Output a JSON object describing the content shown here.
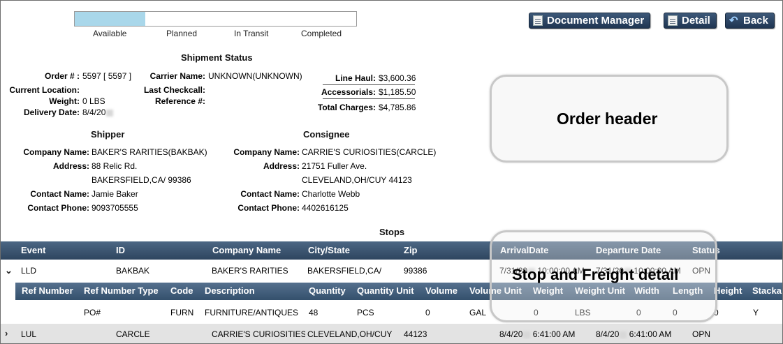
{
  "progress": {
    "fill_fraction": 0.25,
    "stages": [
      "Available",
      "Planned",
      "In Transit",
      "Completed"
    ]
  },
  "buttons": {
    "document_manager": "Document Manager",
    "detail": "Detail",
    "back": "Back"
  },
  "shipment_status": {
    "title": "Shipment Status",
    "order_label": "Order # :",
    "order_value": "5597 [ 5597 ]",
    "current_location_label": "Current Location:",
    "current_location_value": "",
    "weight_label": "Weight:",
    "weight_value": "0 LBS",
    "delivery_date_label": "Delivery Date:",
    "delivery_date_value": "8/4/20",
    "carrier_name_label": "Carrier Name:",
    "carrier_name_value": "UNKNOWN(UNKNOWN)",
    "last_checkcall_label": "Last Checkcall:",
    "last_checkcall_value": "",
    "reference_label": "Reference #:",
    "reference_value": "",
    "line_haul_label": "Line Haul:",
    "line_haul_value": "$3,600.36",
    "accessorials_label": "Accessorials:",
    "accessorials_value": "$1,185.50",
    "total_charges_label": "Total Charges:",
    "total_charges_value": "$4,785.86"
  },
  "shipper": {
    "title": "Shipper",
    "company_label": "Company Name:",
    "company_value": "BAKER'S RARITIES(BAKBAK)",
    "address_label": "Address:",
    "address_line1": "88 Relic Rd.",
    "address_line2": "BAKERSFIELD,CA/ 99386",
    "contact_name_label": "Contact Name:",
    "contact_name_value": "Jamie Baker",
    "contact_phone_label": "Contact Phone:",
    "contact_phone_value": "9093705555"
  },
  "consignee": {
    "title": "Consignee",
    "company_label": "Company Name:",
    "company_value": "CARRIE'S CURIOSITIES(CARCLE)",
    "address_label": "Address:",
    "address_line1": "21751 Fuller Ave.",
    "address_line2": "CLEVELAND,OH/CUY 44123",
    "contact_name_label": "Contact Name:",
    "contact_name_value": "Charlotte Webb",
    "contact_phone_label": "Contact Phone:",
    "contact_phone_value": "4402616125"
  },
  "callouts": {
    "order_header": "Order header",
    "stop_freight": "Stop and Freight detail"
  },
  "stops": {
    "title": "Stops",
    "columns": [
      "Event",
      "ID",
      "Company Name",
      "City/State",
      "Zip",
      "ArrivalDate",
      "Departure Date",
      "Status"
    ],
    "rows": [
      {
        "expand": "⌄",
        "event": "LLD",
        "id": "BAKBAK",
        "company": "BAKER'S RARITIES",
        "city": "BAKERSFIELD,CA/",
        "zip": "99386",
        "arrival_prefix": "7/31/20",
        "arrival_time": "10:00:00 AM",
        "departure_prefix": "7/31/20",
        "departure_time": "10:00:00 AM",
        "status": "OPN"
      },
      {
        "expand": "›",
        "event": "LUL",
        "id": "CARCLE",
        "company": "CARRIE'S CURIOSITIES",
        "city": "CLEVELAND,OH/CUY",
        "zip": "44123",
        "arrival_prefix": "8/4/20",
        "arrival_time": "6:41:00 AM",
        "departure_prefix": "8/4/20",
        "departure_time": "6:41:00 AM",
        "status": "OPN"
      }
    ]
  },
  "freight": {
    "columns": [
      "Ref Number",
      "Ref Number Type",
      "Code",
      "Description",
      "Quantity",
      "Quantity Unit",
      "Volume",
      "Volume Unit",
      "Weight",
      "Weight Unit",
      "Width",
      "Length",
      "Height",
      "Stacka"
    ],
    "rows": [
      {
        "ref_number": "",
        "ref_type": "PO#",
        "code": "FURN",
        "description": "FURNITURE/ANTIQUES",
        "quantity": "48",
        "quantity_unit": "PCS",
        "volume": "0",
        "volume_unit": "GAL",
        "weight": "0",
        "weight_unit": "LBS",
        "width": "0",
        "length": "0",
        "height": "0",
        "stackable": "Y"
      }
    ]
  }
}
